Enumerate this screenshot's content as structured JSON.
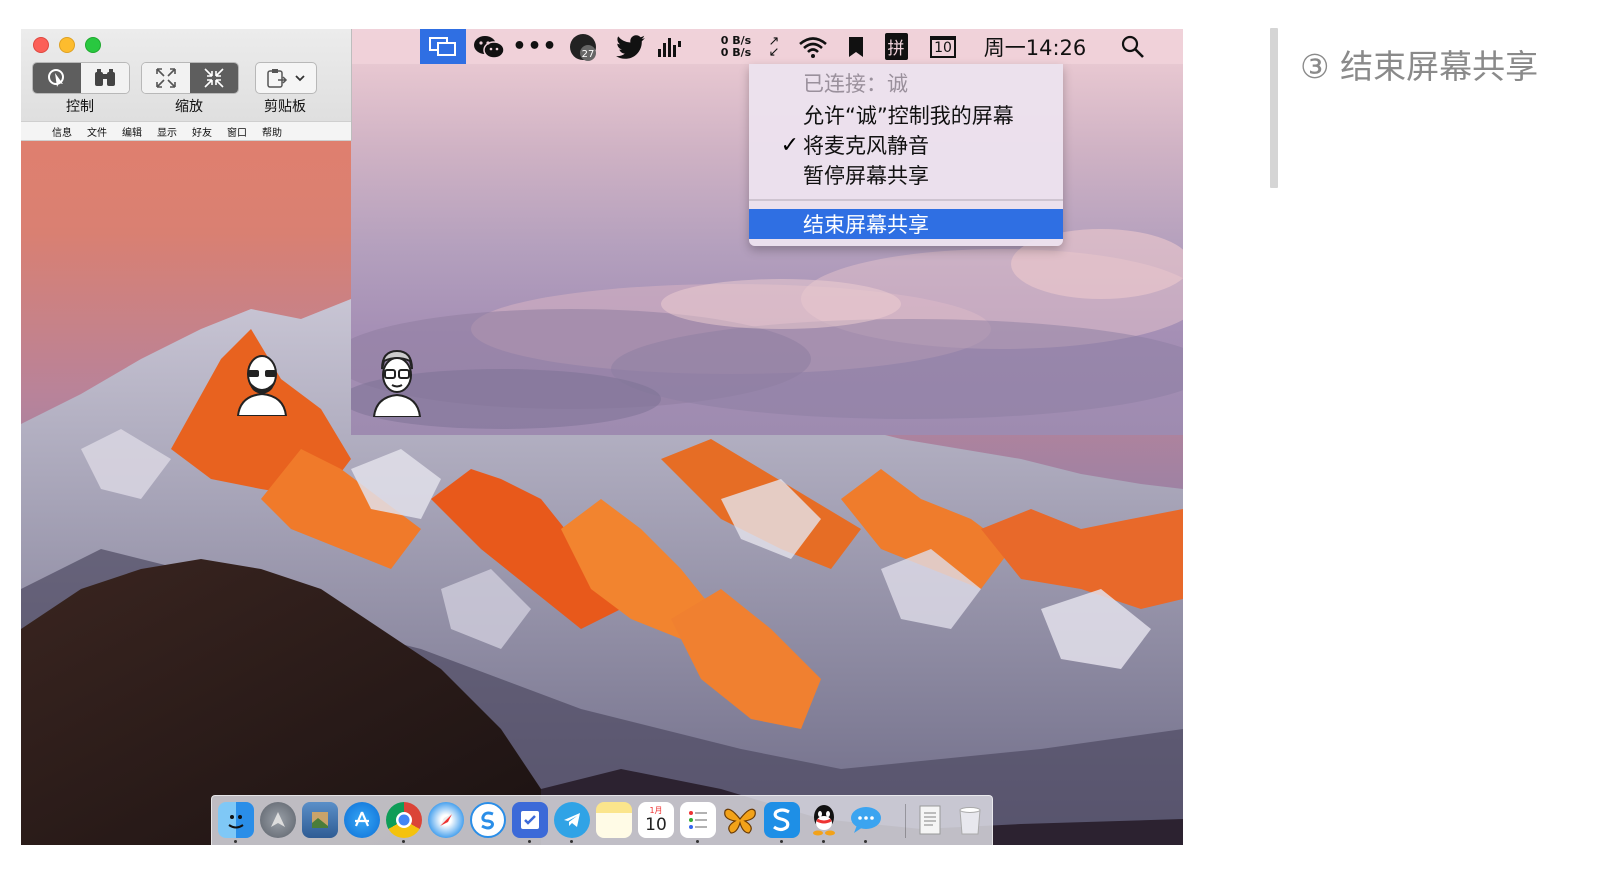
{
  "app_window": {
    "toolbar": {
      "control_label": "控制",
      "zoom_label": "缩放",
      "clipboard_label": "剪贴板"
    },
    "inner_menu": {
      "apple_icon": "apple-icon",
      "items": [
        "信息",
        "文件",
        "编辑",
        "显示",
        "好友",
        "窗口",
        "帮助"
      ]
    }
  },
  "remote_menubar": {
    "dots": "•••",
    "badge_count": "27",
    "net_up": "0 B/s",
    "net_down": "0 B/s",
    "pinyin": "拼",
    "calendar_day": "10",
    "clock": "周一14:26",
    "active_color": "#2f6fe3"
  },
  "share_menu": {
    "connected_label": "已连接：诚",
    "allow_control_label": "允许“诚”控制我的屏幕",
    "mute_check": "✓",
    "mute_label": "将麦克风静音",
    "pause_label": "暂停屏幕共享",
    "end_label": "结束屏幕共享"
  },
  "dock": {
    "calendar_day": "10",
    "calendar_month": "1月",
    "icons": [
      "finder-icon",
      "launchpad-icon",
      "preview-icon",
      "app-store-icon",
      "chrome-icon",
      "safari-icon",
      "skype-icon",
      "reminders-icon",
      "telegram-icon",
      "notes-icon",
      "calendar-icon",
      "lists-icon",
      "butterfly-app-icon",
      "s-app-icon",
      "qq-icon",
      "messages-icon",
      "document-icon",
      "trash-icon"
    ]
  },
  "annotation": {
    "step_text": "③ 结束屏幕共享"
  }
}
